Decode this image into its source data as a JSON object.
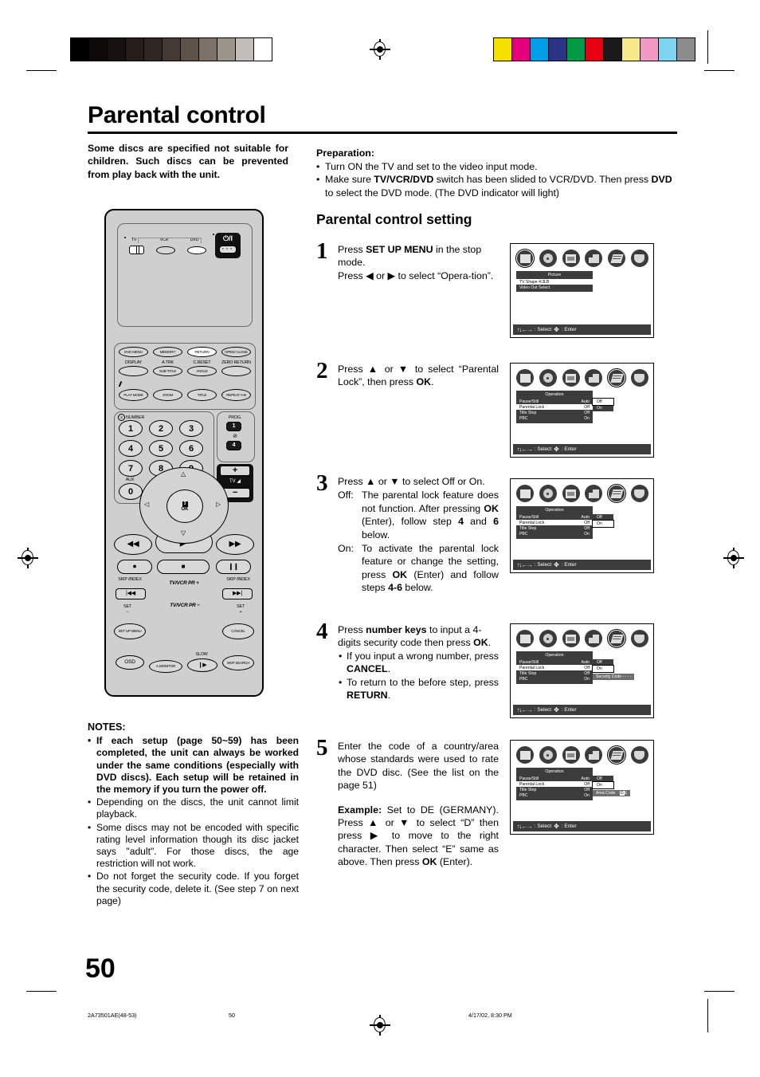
{
  "page": {
    "title": "Parental control",
    "number": "50"
  },
  "intro": "Some discs are specified not suitable for children. Such discs can be prevented from play back with the unit.",
  "preparation": {
    "heading": "Preparation:",
    "items": [
      "Turn ON the TV and set to the video input mode.",
      "Make sure TV/VCR/DVD switch has been slided to VCR/DVD. Then press DVD to select the DVD mode. (The DVD indicator will light)"
    ]
  },
  "section_heading": "Parental control setting",
  "steps": {
    "s1": {
      "num": "1",
      "l1a": "Press ",
      "l1b": "SET UP MENU",
      "l1c": " in the stop mode.",
      "l2": "Press ◀ or ▶ to select “Opera-tion”."
    },
    "s2": {
      "num": "2",
      "l1": "Press ▲ or ▼ to select “Parental Lock”, then press ",
      "l1b": "OK",
      "l1c": "."
    },
    "s3": {
      "num": "3",
      "l1": "Press ▲ or ▼ to select Off or On.",
      "off_key": "Off:",
      "off_v1": "The parental lock feature does not function. After pressing ",
      "off_ok": "OK",
      "off_v2": " (Enter), follow step ",
      "off_n1": "4",
      "off_v3": " and ",
      "off_n2": "6",
      "off_v4": " below.",
      "on_key": "On:",
      "on_v1": "To activate the parental lock feature or change the setting, press ",
      "on_ok": "OK",
      "on_v2": " (Enter) and follow steps ",
      "on_n": "4-6",
      "on_v3": " below."
    },
    "s4": {
      "num": "4",
      "l1a": "Press ",
      "l1b": "number keys",
      "l1c": " to input a 4-digits security code then press ",
      "l1d": "OK",
      "l1e": ".",
      "b1a": "If you input a wrong number, press ",
      "b1b": "CANCEL",
      "b1c": ".",
      "b2a": "To return to the before step, press ",
      "b2b": "RETURN",
      "b2c": "."
    },
    "s5": {
      "num": "5",
      "l1": "Enter the code of a country/area whose standards were used to rate the DVD disc. (See the list on the page 51)",
      "ex_label": "Example:",
      "ex_1": " Set to DE (GERMANY). Press ▲ or ▼ to select “D” then press ▶ to move to the right character. Then select “E” same as above. Then press ",
      "ex_ok": "OK",
      "ex_2": " (Enter)."
    }
  },
  "osd": {
    "footer_select": ": Select",
    "footer_enter": ": Enter",
    "footer_arrows": "↑↓←→",
    "screen1": {
      "menu_title": "Picture",
      "rows": [
        {
          "label": "TV Shape 4:3LB",
          "value": "",
          "highlight": true
        },
        {
          "label": "Video Out Select",
          "value": "",
          "highlight": false
        }
      ]
    },
    "screen2": {
      "menu_title": "Operation",
      "rows": [
        {
          "label": "Pause/Still",
          "value": "Auto",
          "highlight": false
        },
        {
          "label": "Parental Lock",
          "value": "Off",
          "highlight": true
        },
        {
          "label": "Title Stop",
          "value": "Off",
          "highlight": false
        },
        {
          "label": "PBC",
          "value": "On",
          "highlight": false
        }
      ],
      "options": [
        {
          "label": "Off",
          "highlight": true
        },
        {
          "label": "On",
          "highlight": false
        }
      ]
    },
    "screen3": {
      "menu_title": "Operation",
      "rows": [
        {
          "label": "Pause/Still",
          "value": "Auto",
          "highlight": false
        },
        {
          "label": "Parental Lock",
          "value": "Off",
          "highlight": true
        },
        {
          "label": "Title Stop",
          "value": "Off",
          "highlight": false
        },
        {
          "label": "PBC",
          "value": "On",
          "highlight": false
        }
      ],
      "options": [
        {
          "label": "Off",
          "highlight": false
        },
        {
          "label": "On",
          "highlight": true
        }
      ]
    },
    "screen4": {
      "menu_title": "Operation",
      "rows": [
        {
          "label": "Pause/Still",
          "value": "Auto",
          "highlight": false
        },
        {
          "label": "Parental Lock",
          "value": "Off",
          "highlight": true
        },
        {
          "label": "Title Stop",
          "value": "Off",
          "highlight": false
        },
        {
          "label": "PBC",
          "value": "On",
          "highlight": false
        }
      ],
      "options": [
        {
          "label": "Off",
          "highlight": false
        },
        {
          "label": "On",
          "highlight": true
        }
      ],
      "extra_label": "Security Code",
      "extra_value": "- - - -"
    },
    "screen5": {
      "menu_title": "Operation",
      "rows": [
        {
          "label": "Pause/Still",
          "value": "Auto",
          "highlight": false
        },
        {
          "label": "Parental Lock",
          "value": "Off",
          "highlight": true
        },
        {
          "label": "Title Stop",
          "value": "Off",
          "highlight": false
        },
        {
          "label": "PBC",
          "value": "On",
          "highlight": false
        }
      ],
      "options": [
        {
          "label": "Off",
          "highlight": false
        },
        {
          "label": "On",
          "highlight": true
        }
      ],
      "extra_label": "Area Code",
      "extra_value_hl": "D",
      "extra_value_rest": "E"
    }
  },
  "remote": {
    "mode_labels": {
      "tv": "TV",
      "vcr": "VCR",
      "dvd": "DVD"
    },
    "power": "⏻/I",
    "row1": [
      "DVD MENU",
      "MEMORY",
      "RETURN",
      "OPEN/ CLOSE"
    ],
    "row2_labels": [
      "DISPLAY",
      "A.TRK",
      "C.RESET",
      "ZERO RETURN"
    ],
    "row2": [
      "",
      "SUB TITLE",
      "ANGLE",
      ""
    ],
    "row3": [
      "PLAY MODE",
      "ZOOM",
      "TITLE",
      "REPEAT A-B"
    ],
    "number_header": "NUMBER",
    "number_mark": "2",
    "numbers": [
      "1",
      "2",
      "3",
      "4",
      "5",
      "6",
      "7",
      "8",
      "9",
      "0"
    ],
    "aux_label": "AUX",
    "tv_small_label": "TV",
    "tvvcr": "TV/VCR",
    "prog_label": "PROG.",
    "prog_1": "1",
    "prog_4": "4",
    "vol_plus": "+",
    "vol_minus": "−",
    "vol_label": "TV",
    "skip_index": "SKIP /INDEX",
    "set_minus_a": "SET",
    "set_minus_b": "−",
    "set_plus_a": "SET",
    "set_plus_b": "+",
    "setup_menu": "SET UP MENU",
    "cancel": "CANCEL",
    "ok": "OK",
    "ok_mark": "3",
    "pr_up": "TV/VCR PR +",
    "pr_down": "TV/VCR PR −",
    "osd_btn": "OSD",
    "amonitor": "A.MONITOR",
    "slow": "SLOW",
    "skip_search": "SKIP SEARCH"
  },
  "notes": {
    "heading": "NOTES:",
    "items": [
      {
        "bold": true,
        "text": "If each setup (page 50~59) has been completed, the unit can always be worked under the same conditions (especially with DVD discs). Each setup will be retained in the memory if you turn the power off."
      },
      {
        "bold": false,
        "text": "Depending on the discs, the unit cannot limit playback."
      },
      {
        "bold": false,
        "text": "Some discs may not be encoded with specific rating level information though its disc jacket says \"adult\". For those discs, the age restriction will not work."
      },
      {
        "bold": false,
        "text": "Do not forget the security code. If you forget the security code, delete it. (See step 7 on next page)"
      }
    ]
  },
  "footer": {
    "left": "2A73501AE(48-53)",
    "page": "50",
    "date": "4/17/02, 8:30 PM"
  },
  "colors": {
    "gray_ramp": [
      "#000000",
      "#0d0a09",
      "#17120f",
      "#241d19",
      "#2f2721",
      "#443a33",
      "#5e5349",
      "#7c7269",
      "#9c938b",
      "#c3bdb7",
      "#ffffff"
    ],
    "color_ramp": [
      "#f5e000",
      "#e6007e",
      "#00a0e9",
      "#2b3383",
      "#009944",
      "#e60012",
      "#1a1a1a",
      "#f7e98a",
      "#f09ac4",
      "#7fd4f4",
      "#8d8d8d"
    ]
  }
}
